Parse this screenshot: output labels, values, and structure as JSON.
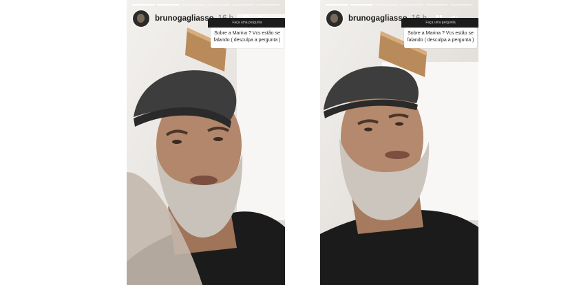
{
  "stories": [
    {
      "username": "brunogagliasso",
      "time": "16 h",
      "question_header": "Faça uma pergunta",
      "question_text": "Sobre a Marina ? Vcs estão se falando ( desculpa a pergunta )",
      "sound_icon": "volume-muted-icon",
      "progress": {
        "segments": 6,
        "completed": 2
      }
    },
    {
      "username": "brunogagliasso",
      "time": "16 h",
      "question_header": "Faça uma pergunta",
      "question_text": "Sobre a Marina ? Vcs estão se falando ( desculpa a pergunta )",
      "sound_icon": "volume-icon",
      "progress": {
        "segments": 6,
        "completed": 2
      }
    }
  ],
  "colors": {
    "wall": "#ededeb",
    "beard": "#bdb6ad",
    "cap": "#3a3a3a",
    "shirt": "#1a1a1a",
    "skin": "#b08468"
  }
}
